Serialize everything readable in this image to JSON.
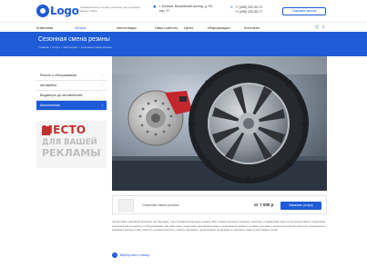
{
  "header": {
    "logo": "Logo",
    "tagline": "Универсальное готовое решение для создания вашего сайта",
    "address": "г. Москва, Валуевский проезд, д. 53, кор. 37",
    "phones": [
      "+7 (495) 222-90-72",
      "+7 (495) 222-90-77"
    ],
    "callback_label": "Заказать звонок"
  },
  "nav": {
    "items": [
      "Компания",
      "Услуги",
      "Автотовары",
      "Наши работы",
      "Цены",
      "Информация",
      "Контакты"
    ],
    "active": "Услуги"
  },
  "banner": {
    "title": "Сезонная смена резины",
    "breadcrumb": "Главная  >  Услуги  >  Автосервис  >  Сезонная смена резины"
  },
  "sidebar": {
    "items": [
      {
        "label": "Ремонт и обслуживание",
        "active": false
      },
      {
        "label": "Автомойка",
        "active": false
      },
      {
        "label": "Выдвинуть дн автомобилей",
        "active": false
      },
      {
        "label": "Шиномонтаж",
        "active": true
      }
    ]
  },
  "ad": {
    "line1": "МЕСТО",
    "line2": "ДЛЯ ВАШЕЙ",
    "line3": "РЕКЛАМЫ"
  },
  "order": {
    "name": "Сезонная смена резины",
    "price": "от 7 000 р",
    "button": "Заказать услугу"
  },
  "description": "Ассортимент компании включает как бытовые, так и профессиональные модели. Все товары проходят проверку качества, а сервисный отдел готов предоставить подробную консультацию по выбору и обслуживанию. Мы работаем с ведущими производителями и предлагаем удобные условия доставки и оплаты для наших клиентов. Специалисты компании всегда готовы ответить на ваши вопросы, помочь подобрать необходимую продукцию и оформить заказ в кратчайшие сроки.",
  "back_label": "Вернуться к списку",
  "colors": {
    "primary": "#1e5bd6",
    "ad_red": "#c32f2f",
    "ad_grey": "#bdbdbd"
  }
}
